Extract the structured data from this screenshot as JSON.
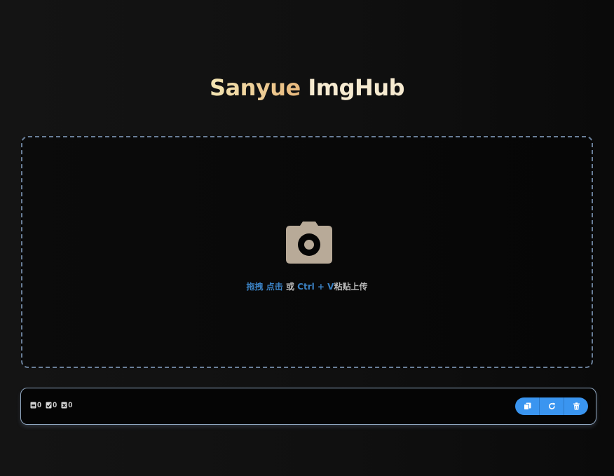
{
  "header": {
    "brand": "Sanyue",
    "product": "ImgHub"
  },
  "upload": {
    "icon": "camera-icon",
    "text_drag": "拖拽",
    "text_click": "点击",
    "text_or": "或",
    "text_shortcut": "Ctrl + V",
    "text_paste": "粘贴上传"
  },
  "status": {
    "total": "0",
    "success": "0",
    "failed": "0"
  },
  "actions": [
    {
      "icon": "copy-icon"
    },
    {
      "icon": "retry-icon"
    },
    {
      "icon": "trash-icon"
    }
  ],
  "colors": {
    "accent": "#3a95f0",
    "highlight_text": "#3b82c4",
    "dashed_border": "#6a7f99",
    "title_gold": "#e8b87c"
  }
}
